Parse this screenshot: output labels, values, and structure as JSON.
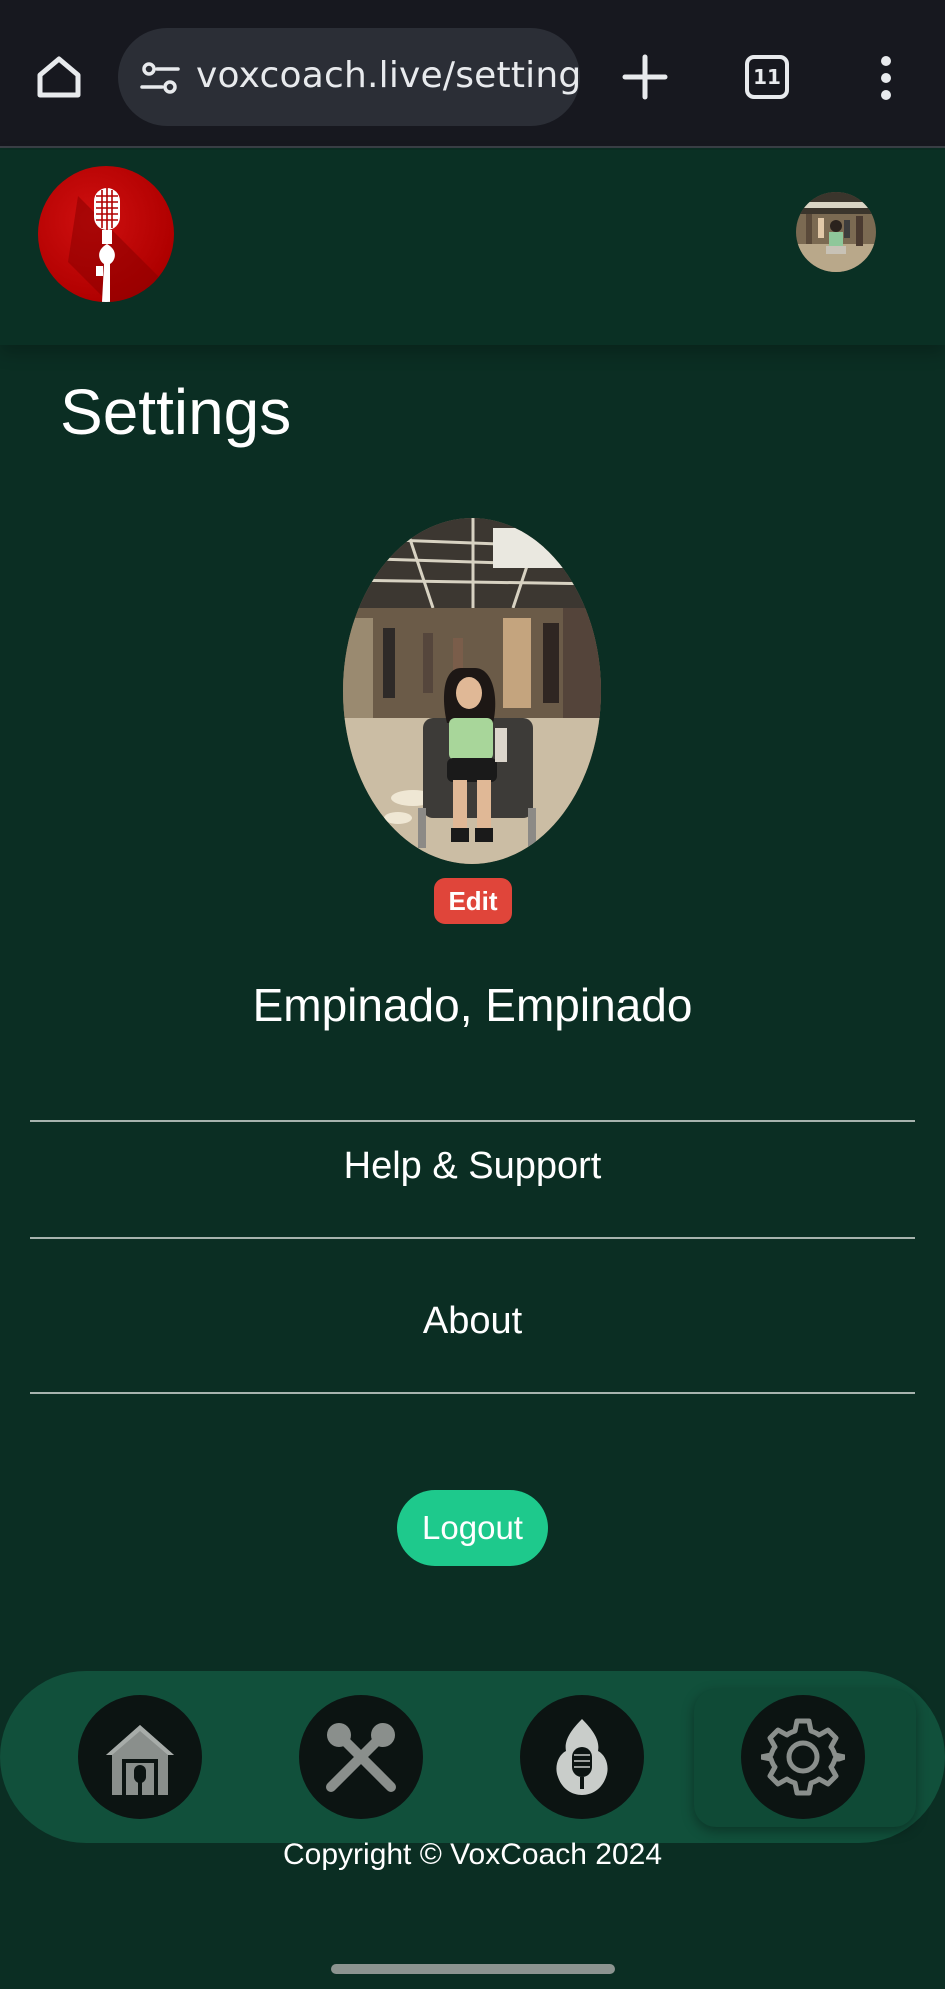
{
  "browser": {
    "url": "voxcoach.live/settings",
    "tab_count": "11",
    "icons": {
      "home": "home-icon",
      "site_settings": "tune-icon",
      "new_tab": "plus-icon",
      "tabs": "tab-switcher-icon",
      "menu": "more-vert-icon"
    }
  },
  "header": {
    "logo": "microphone-logo",
    "avatar": "user-avatar"
  },
  "page": {
    "title": "Settings"
  },
  "profile": {
    "edit_label": "Edit",
    "name": "Empinado, Empinado"
  },
  "menu": {
    "items": [
      {
        "label": "Help & Support"
      },
      {
        "label": "About"
      }
    ]
  },
  "actions": {
    "logout_label": "Logout"
  },
  "bottom_nav": {
    "items": [
      {
        "icon": "home-icon"
      },
      {
        "icon": "crossed-microphones-icon"
      },
      {
        "icon": "flame-microphone-icon"
      },
      {
        "icon": "settings-gear-icon",
        "active": true
      }
    ]
  },
  "footer": {
    "copyright": "Copyright © VoxCoach 2024"
  },
  "colors": {
    "background": "#0b2e23",
    "edit_button": "#e0453a",
    "logout_button": "#1ec98c",
    "nav_bar": "#11503b",
    "logo_red": "#b00000"
  }
}
